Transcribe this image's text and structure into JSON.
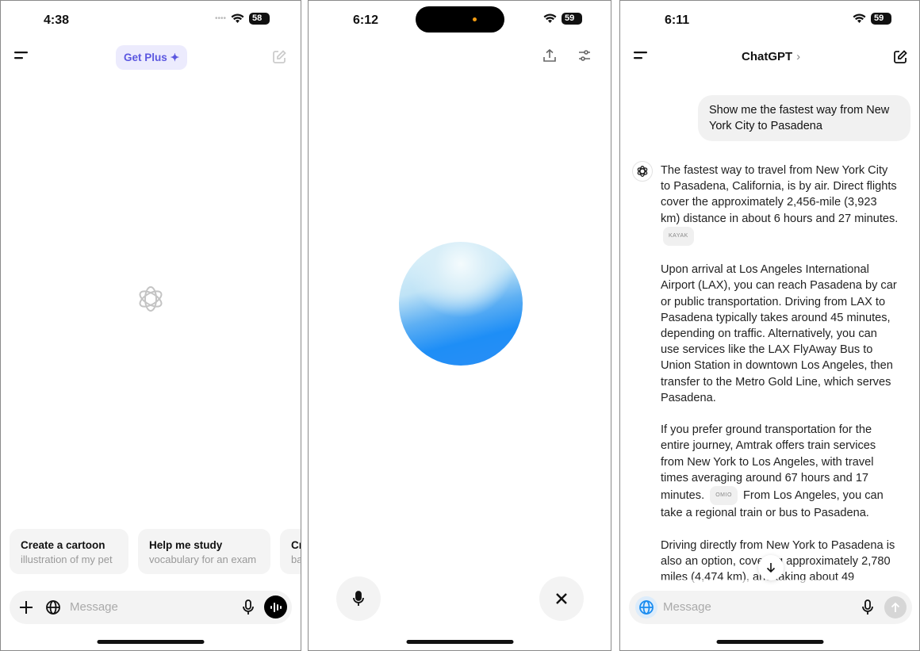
{
  "screen1": {
    "time": "4:38",
    "battery": "58",
    "get_plus_label": "Get Plus",
    "suggestions": [
      {
        "title": "Create a cartoon",
        "subtitle": "illustration of my pet"
      },
      {
        "title": "Help me study",
        "subtitle": "vocabulary for an exam"
      },
      {
        "title": "Cr",
        "subtitle": "ba"
      }
    ],
    "message_placeholder": "Message",
    "icons": [
      "menu-icon",
      "new-chat-icon",
      "openai-logo-icon",
      "plus-icon",
      "globe-icon",
      "microphone-icon",
      "voice-mode-icon"
    ]
  },
  "screen2": {
    "time": "6:12",
    "battery": "59",
    "icons": [
      "share-icon",
      "settings-sliders-icon",
      "microphone-icon",
      "close-icon"
    ],
    "orb_colors": [
      "#1d8cf8",
      "#7fc4f5",
      "#eef8fb"
    ]
  },
  "screen3": {
    "time": "6:11",
    "battery": "59",
    "title": "ChatGPT",
    "user_message": "Show me the fastest way from New York City to Pasadena",
    "answer": {
      "p1": "The fastest way to travel from New York City to Pasadena, California, is by air. Direct flights cover the approximately 2,456-mile (3,923 km) distance in about 6 hours and 27 minutes.",
      "p1_source": "KAYAK",
      "p2": "Upon arrival at Los Angeles International Airport (LAX), you can reach Pasadena by car or public transportation. Driving from LAX to Pasadena typically takes around 45 minutes, depending on traffic. Alternatively, you can use services like the LAX FlyAway Bus to Union Station in downtown Los Angeles, then transfer to the Metro Gold Line, which serves Pasadena.",
      "p3a": "If you prefer ground transportation for the entire journey, Amtrak offers train services from New York to Los Angeles, with travel times averaging around 67 hours and 17 minutes.",
      "p3_source": "OMIO",
      "p3b": "From Los Angeles, you can take a regional train or bus to Pasadena.",
      "p4": "Driving directly from New York to Pasadena is also an option, covering approximately 2,780 miles (4,474 km), and taking about 49"
    },
    "message_placeholder": "Message",
    "accent": "#1a8cf0"
  }
}
